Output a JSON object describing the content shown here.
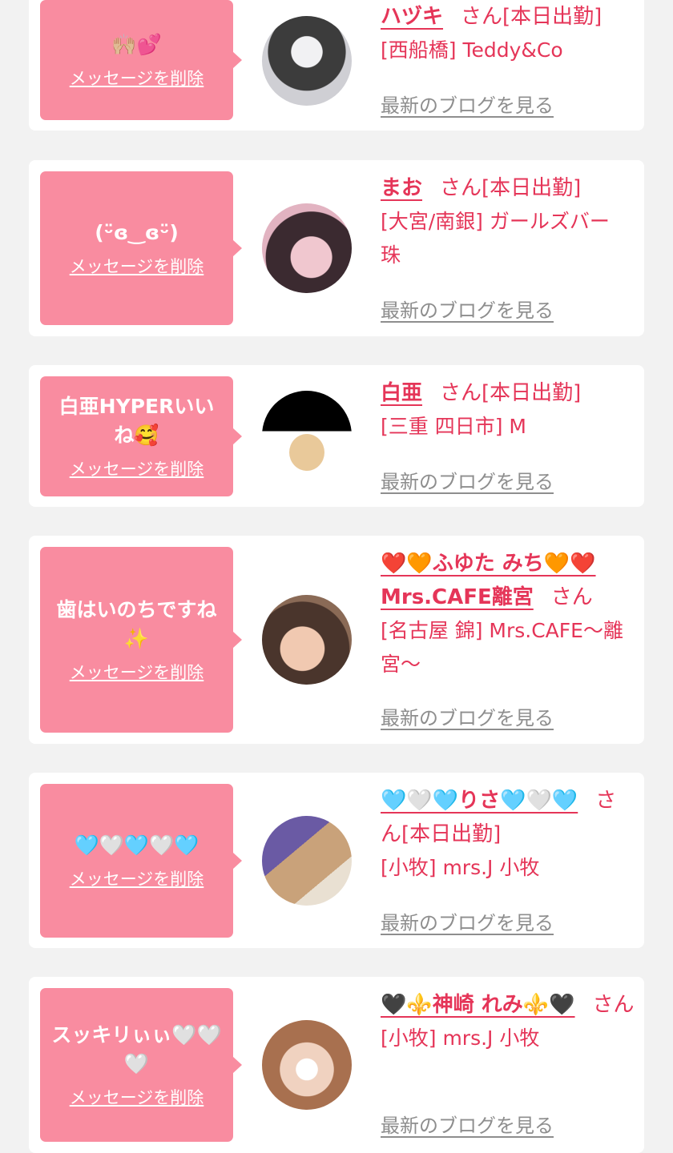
{
  "actions": {
    "delete_label": "メッセージを削除",
    "blog_label": "最新のブログを見る",
    "honorific": "さん"
  },
  "cards": [
    {
      "message": "🙌🏼💕",
      "name": "ハヅキ",
      "status": "[本日出勤]",
      "shop": "[西船橋] Teddy&Co",
      "avatar_icon": "person-photo-icon",
      "avatar_colors": [
        "#cfcfd4",
        "#3a3a3a"
      ]
    },
    {
      "message": "(ᵕ̈ɞ‿ɞᵕ̈)",
      "name": "まお",
      "status": "[本日出勤]",
      "shop": "[大宮/南銀] ガールズバー 珠",
      "avatar_icon": "person-photo-icon",
      "avatar_colors": [
        "#e3b2c0",
        "#4a3338"
      ]
    },
    {
      "message": "白亜HYPERいいね🥰",
      "name": "白亜",
      "status": "[本日出勤]",
      "shop": "[三重 四日市] M",
      "avatar_icon": "person-photo-icon",
      "avatar_colors": [
        "#000000",
        "#d9e4ee"
      ]
    },
    {
      "message": "歯はいのちですね✨",
      "name": "❤️🧡ふゆた みち🧡❤️Mrs.CAFE離宮",
      "status": "",
      "shop": "[名古屋 錦] Mrs.CAFE〜離宮〜",
      "avatar_icon": "person-photo-icon",
      "avatar_colors": [
        "#7a5b4a",
        "#e8c2a8"
      ]
    },
    {
      "message": "🩵🤍🩵🤍🩵",
      "name": "🩵🤍🩵りさ🩵🤍🩵",
      "status": "[本日出勤]",
      "shop": "[小牧] mrs.J 小牧",
      "avatar_icon": "person-photo-icon",
      "avatar_colors": [
        "#6e5fa8",
        "#d8c3a6"
      ]
    },
    {
      "message": "スッキリぃぃ🤍🤍🤍",
      "name": "🖤⚜️神崎 れみ⚜️🖤",
      "status": "",
      "shop": "[小牧] mrs.J 小牧",
      "avatar_icon": "person-photo-icon",
      "avatar_colors": [
        "#b07a5c",
        "#f0d8c8"
      ]
    }
  ]
}
